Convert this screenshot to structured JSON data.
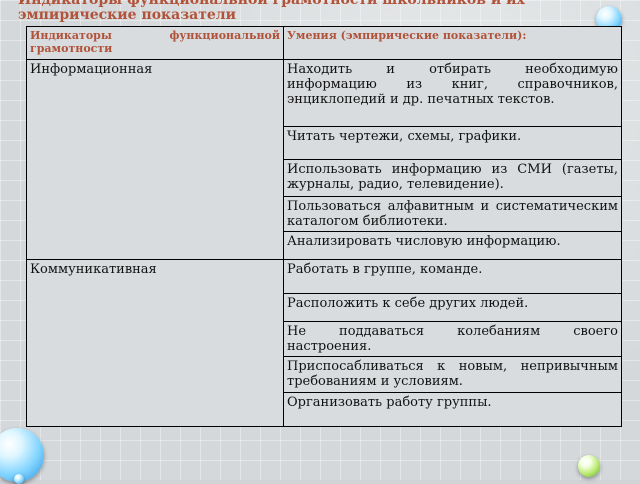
{
  "title": "Индикаторы функциональной грамотности школьников и их эмпирические показатели",
  "table": {
    "headers": [
      "Индикаторы функциональной грамотности",
      "Умения (эмпирические показатели):"
    ],
    "groups": [
      {
        "indicator": "Информационная",
        "skills": [
          "Находить и отбирать необходимую информацию из книг, справочников, энциклопедий и др. печатных текстов.",
          "Читать чертежи, схемы, графики.",
          "Использовать информацию из СМИ (газеты, журналы, радио, телевидение).",
          "Пользоваться алфавитным и систематическим каталогом библиотеки.",
          "Анализировать числовую информацию."
        ]
      },
      {
        "indicator": "Коммуникативная",
        "skills": [
          "Работать в группе, команде.",
          "Расположить к себе других людей.",
          "Не поддаваться колебаниям своего настроения.",
          "Приспосабливаться к новым, непривычным требованиям и условиям.",
          "Организовать работу группы."
        ]
      }
    ]
  }
}
